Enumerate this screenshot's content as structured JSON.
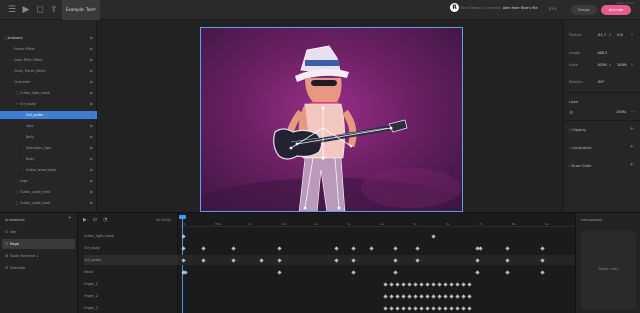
{
  "topbar": {
    "tab_title": "Example: Tom Metallo",
    "editing_prefix": "Rive Editor is currently",
    "editing_file": "Alex from Rive's file",
    "zoom": "82%",
    "design_label": "Design",
    "animate_label": "Animate",
    "beta": "Beta 0.5.92"
  },
  "hierarchy": [
    {
      "label": "Artboard",
      "indent": 0,
      "icon": "artboard-icon",
      "glyph": "▢"
    },
    {
      "label": "Frame Effect",
      "indent": 1,
      "icon": "group-icon",
      "glyph": "◦"
    },
    {
      "label": "Color Filter Effect",
      "indent": 1,
      "icon": "group-icon",
      "glyph": "◦"
    },
    {
      "label": "Grain_Flares_effect",
      "indent": 1,
      "icon": "group-icon",
      "glyph": "◦"
    },
    {
      "label": "Character",
      "indent": 1,
      "icon": "group-icon",
      "glyph": "◦"
    },
    {
      "label": "Guitar_light_mask",
      "indent": 2,
      "icon": "path-icon",
      "glyph": "∫"
    },
    {
      "label": "Ctrl_body",
      "indent": 2,
      "icon": "bone-icon",
      "glyph": "⌕"
    },
    {
      "label": "Ctrl_guitar",
      "indent": 3,
      "icon": "bone-icon",
      "glyph": "⌕",
      "selected": true
    },
    {
      "label": "Hips",
      "indent": 3,
      "icon": "group-icon",
      "glyph": "◦"
    },
    {
      "label": "Belly",
      "indent": 3,
      "icon": "group-icon",
      "glyph": "◦"
    },
    {
      "label": "Shoulders_light",
      "indent": 3,
      "icon": "group-icon",
      "glyph": "◦"
    },
    {
      "label": "Body",
      "indent": 3,
      "icon": "group-icon",
      "glyph": "◦"
    },
    {
      "label": "Guitar_wood_back",
      "indent": 3,
      "icon": "group-icon",
      "glyph": "◦"
    },
    {
      "label": "Legs",
      "indent": 2,
      "icon": "group-icon",
      "glyph": "◦"
    },
    {
      "label": "Guitar_cable_front",
      "indent": 2,
      "icon": "path-icon",
      "glyph": "∫"
    },
    {
      "label": "Guitar_cable_back",
      "indent": 2,
      "icon": "path-icon",
      "glyph": "∫"
    }
  ],
  "properties": {
    "position_label": "Position",
    "position_x": "-51.7",
    "position_x_unit": "X",
    "position_y": "0.6",
    "position_y_unit": "Y",
    "length_label": "Length",
    "length": "168.3",
    "scale_label": "Scale",
    "scale_x": "100%",
    "scale_x_unit": "X",
    "scale_y": "100%",
    "scale_y_unit": "Y",
    "rotation_label": "Rotation",
    "rotation": "-90°",
    "layer_label": "Layer",
    "layer_opacity": "100%",
    "clipping_label": "Clipping",
    "constraints_label": "Constraints",
    "draw_order_label": "Draw Order"
  },
  "animations": {
    "title": "Animations",
    "items": [
      {
        "label": "Idle",
        "icon": "loop-icon",
        "glyph": "↻"
      },
      {
        "label": "Rage",
        "icon": "loop-icon",
        "glyph": "↻",
        "selected": true
      },
      {
        "label": "State Machine 1",
        "icon": "state-machine-icon",
        "glyph": "⊞"
      },
      {
        "label": "Example",
        "icon": "state-machine-icon",
        "glyph": "⊞"
      }
    ]
  },
  "timeline": {
    "time": "00:00:00",
    "ticks": [
      "00",
      "8fps",
      "1s",
      "10s",
      "2s",
      "3s",
      "4s",
      "5s",
      "6s",
      "7s",
      "8s",
      "9s"
    ],
    "tracks": [
      "Guitar_light_mask",
      "Ctrl_body",
      "Ctrl_guitar",
      "Hand",
      "Finger_1",
      "Finger_2",
      "Finger_3"
    ]
  },
  "interpolation": {
    "title": "Interpolation",
    "select_key": "Select a key"
  },
  "colors": {
    "accent": "#e95a8e",
    "selection": "#3c7fd6",
    "playhead": "#3c9ef0"
  }
}
